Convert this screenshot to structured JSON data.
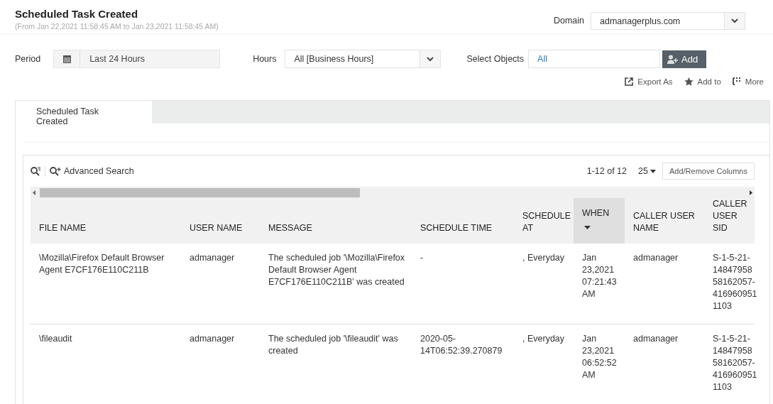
{
  "header": {
    "title": "Scheduled Task Created",
    "subtitle": "(From Jan 22,2021 11:58:45 AM to Jan 23,2021 11:58:45 AM)",
    "domain_label": "Domain",
    "domain_value": "admanagerplus.com"
  },
  "filters": {
    "period_label": "Period",
    "period_value": "Last 24 Hours",
    "hours_label": "Hours",
    "hours_value": "All [Business Hours]",
    "objects_label": "Select Objects",
    "objects_value": "All",
    "add_button": "Add"
  },
  "actions": [
    "Export As",
    "Add to",
    "More"
  ],
  "tabs": [
    {
      "label": "Scheduled Task Created",
      "selected": true
    }
  ],
  "table": {
    "advanced_search": "Advanced Search",
    "pagination": "1-12 of 12",
    "page_size": "25",
    "columns_button": "Add/Remove Columns",
    "columns": [
      {
        "label": "FILE NAME",
        "sorted": false
      },
      {
        "label": "USER NAME",
        "sorted": false
      },
      {
        "label": "MESSAGE",
        "sorted": false
      },
      {
        "label": "SCHEDULE TIME",
        "sorted": false
      },
      {
        "label": "SCHEDULE AT",
        "sorted": false
      },
      {
        "label": "WHEN",
        "sorted": true
      },
      {
        "label": "CALLER USER NAME",
        "sorted": false
      },
      {
        "label": "CALLER USER SID",
        "sorted": false
      }
    ],
    "rows": [
      [
        "\\Mozilla\\Firefox Default Browser Agent E7CF176E110C211B",
        "admanager",
        "The scheduled job '\\Mozilla\\Firefox Default Browser Agent E7CF176E110C211B' was created",
        "-",
        ", Everyday",
        "Jan 23,2021 07:21:43 AM",
        "admanager",
        "S-1-5-21-\n14847958\n58162057-\n416960951\n1103"
      ],
      [
        "\\fileaudit",
        "admanager",
        "The scheduled job '\\fileaudit' was created",
        "2020-05-\n14T06:52:39.270879",
        ", Everyday",
        "Jan 23,2021 06:52:52 AM",
        "admanager",
        "S-1-5-21-\n14847958\n58162057-\n416960951\n1103"
      ]
    ]
  }
}
